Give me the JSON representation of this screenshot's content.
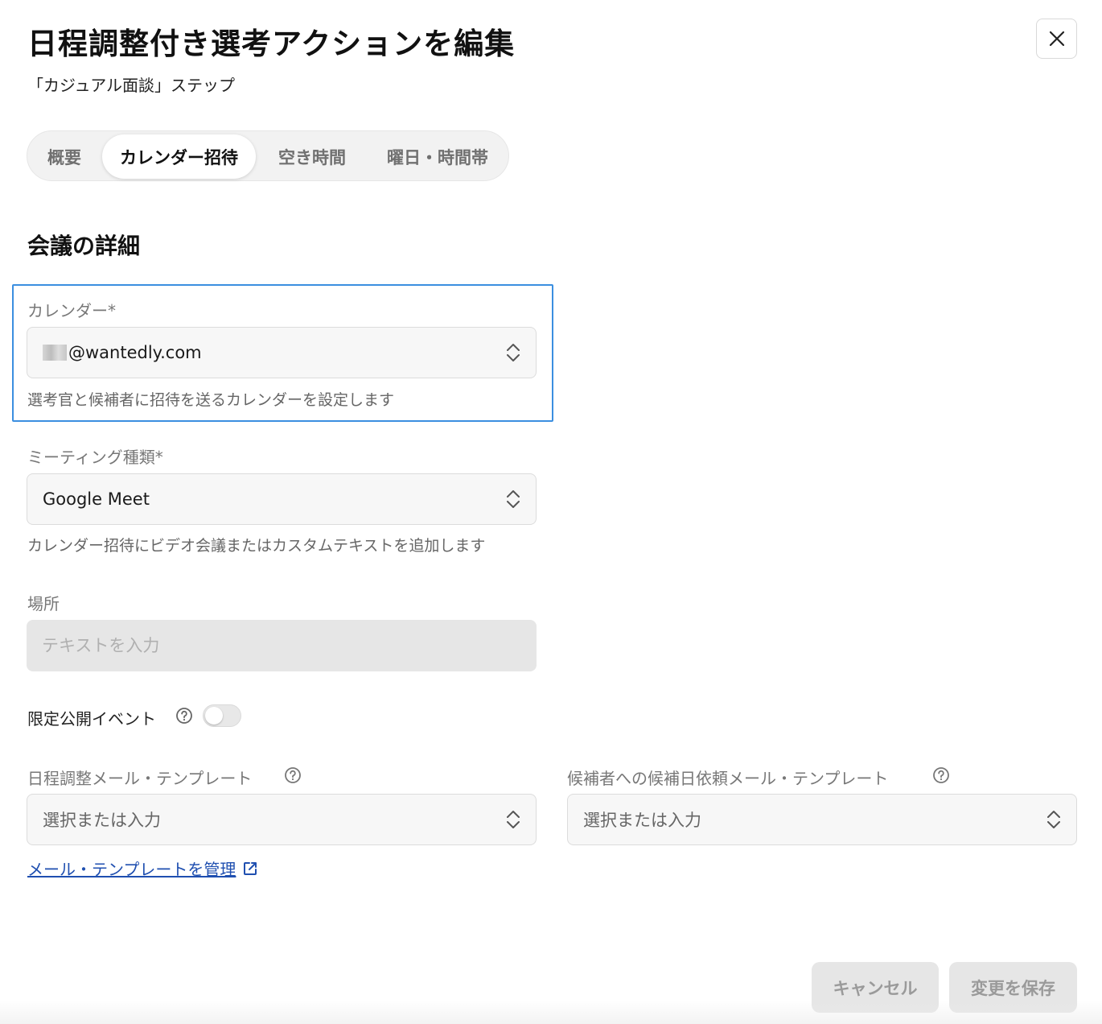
{
  "dialog": {
    "title": "日程調整付き選考アクションを編集",
    "subtitle": "「カジュアル面談」ステップ"
  },
  "tabs": [
    {
      "label": "概要",
      "active": false
    },
    {
      "label": "カレンダー招待",
      "active": true
    },
    {
      "label": "空き時間",
      "active": false
    },
    {
      "label": "曜日・時間帯",
      "active": false
    }
  ],
  "section": {
    "title": "会議の詳細"
  },
  "calendar": {
    "label": "カレンダー*",
    "value": "@wantedly.com",
    "help": "選考官と候補者に招待を送るカレンダーを設定します"
  },
  "meeting_type": {
    "label": "ミーティング種類*",
    "value": "Google Meet",
    "help": "カレンダー招待にビデオ会議またはカスタムテキストを追加します"
  },
  "location": {
    "label": "場所",
    "placeholder": "テキストを入力"
  },
  "private_event": {
    "label": "限定公開イベント",
    "enabled": false
  },
  "schedule_mail_template": {
    "label": "日程調整メール・テンプレート",
    "placeholder": "選択または入力"
  },
  "candidate_mail_template": {
    "label": "候補者への候補日依頼メール・テンプレート",
    "placeholder": "選択または入力"
  },
  "manage_link": {
    "label": "メール・テンプレートを管理"
  },
  "footer": {
    "cancel_label": "キャンセル",
    "save_label": "変更を保存"
  },
  "colors": {
    "focus_border": "#3b8fe0",
    "link": "#1f4fb0",
    "disabled_button_bg": "#e6e6e6"
  },
  "icons": {
    "close": "close-icon",
    "chevron": "chevron-up-down-icon",
    "help": "question-circle-icon",
    "external": "external-link-icon"
  }
}
